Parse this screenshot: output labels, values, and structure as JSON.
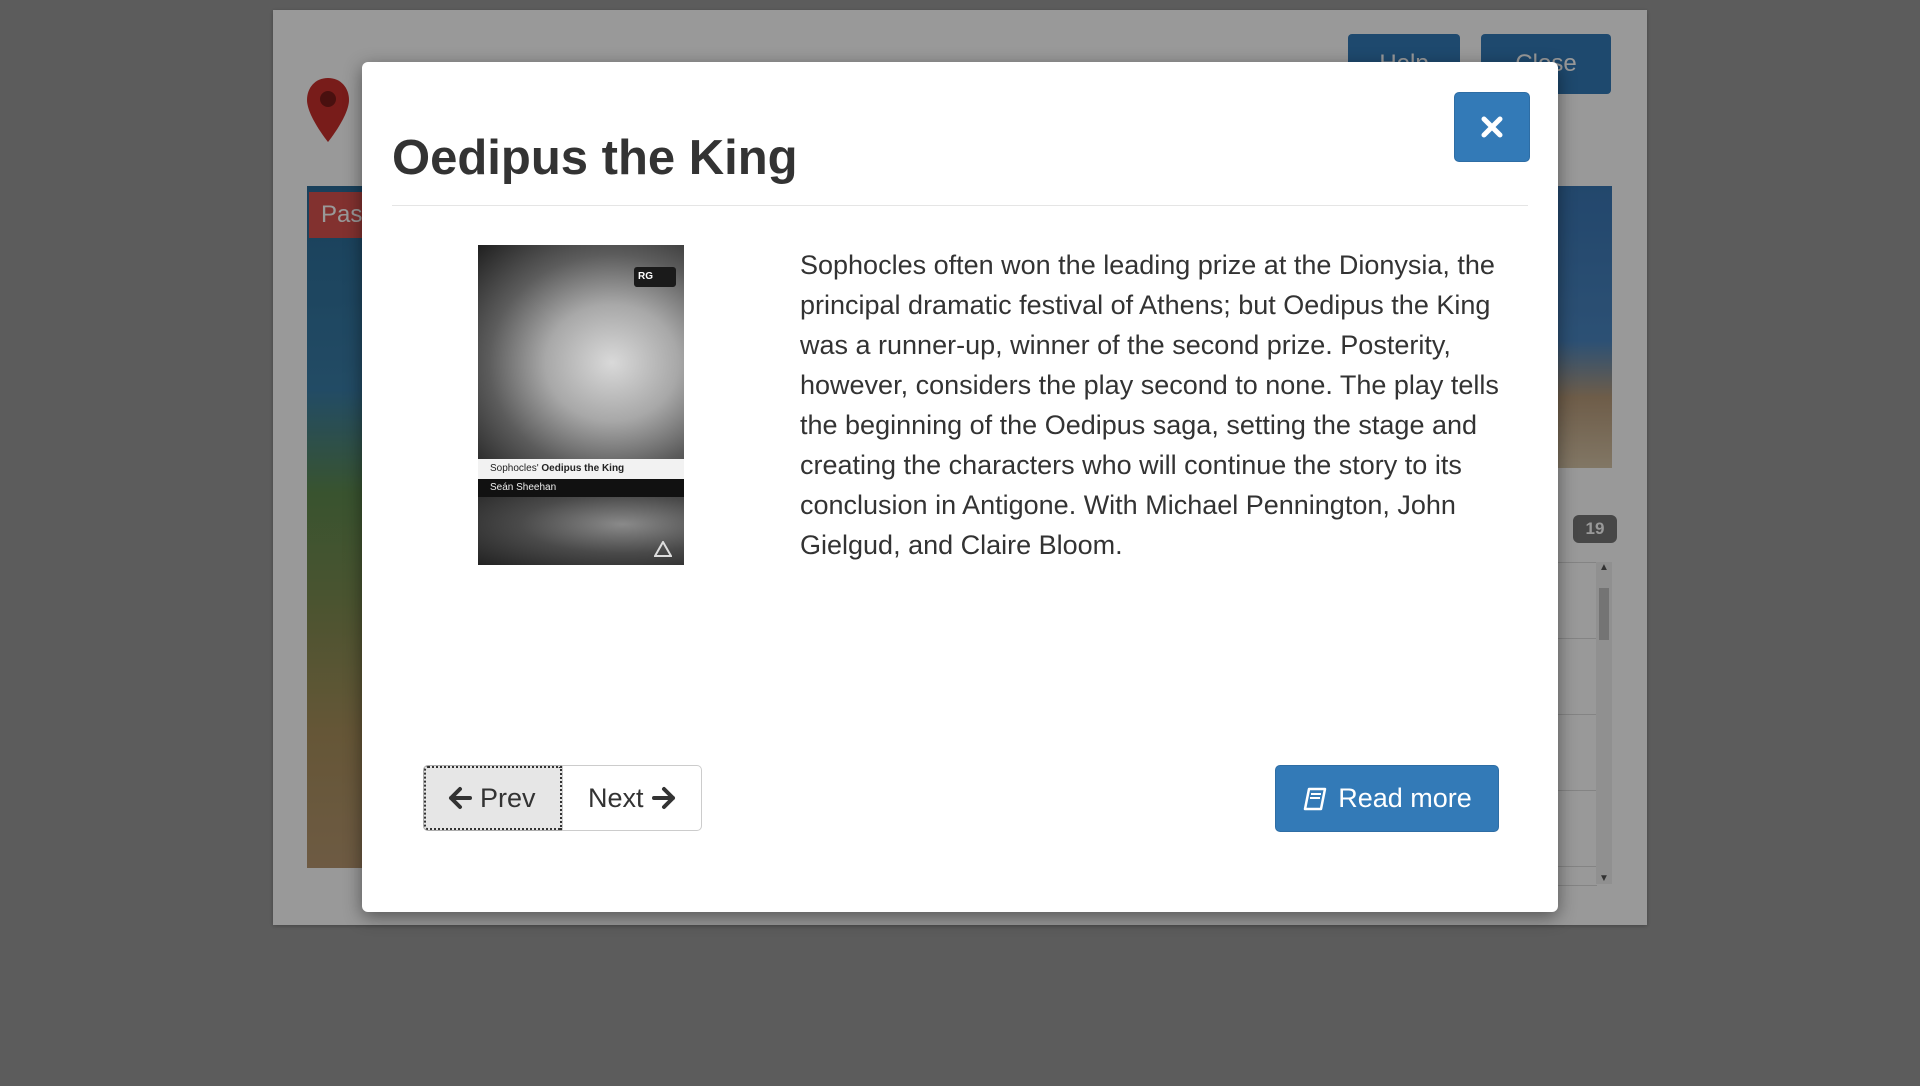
{
  "background": {
    "help_label": "Help",
    "close_label": "Close",
    "tag_label": "Pas",
    "count_badge": "19"
  },
  "modal": {
    "title": "Oedipus the King",
    "description": "Sophocles often won the leading prize at the Dionysia, the principal dramatic festival of Athens; but Oedipus the King was a runner-up, winner of the second prize. Posterity, however, considers the play second to none. The play tells the beginning of the Oedipus saga, setting the stage and creating the characters who will continue the story to its conclusion in Antigone. With Michael Pennington, John Gielgud, and Claire Bloom.",
    "cover": {
      "series_badge": "RG",
      "title_prefix": "Sophocles'",
      "title": "Oedipus the King",
      "author": "Seán Sheehan"
    },
    "prev_label": "Prev",
    "next_label": "Next",
    "read_more_label": "Read more"
  },
  "colors": {
    "primary": "#337ab7",
    "danger": "#d9534f",
    "badge": "#777777"
  },
  "icons": {
    "close": "times-icon",
    "prev": "arrow-left-icon",
    "next": "arrow-right-icon",
    "read_more": "book-icon",
    "map_pin": "map-marker-icon"
  }
}
